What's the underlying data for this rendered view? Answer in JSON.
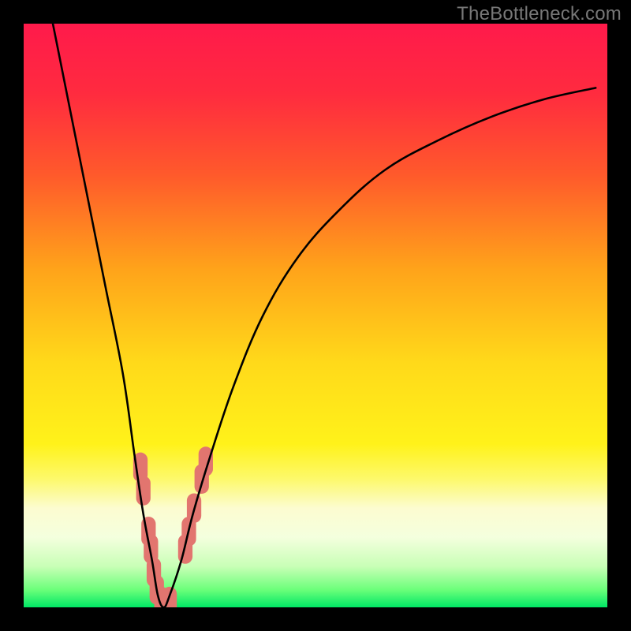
{
  "watermark": "TheBottleneck.com",
  "colors": {
    "frame": "#000000",
    "curve": "#000000",
    "dots": "#e2756f",
    "watermark": "#777777"
  },
  "gradient_stops": [
    {
      "pct": 0,
      "color": "#ff1a4b"
    },
    {
      "pct": 12,
      "color": "#ff2b3f"
    },
    {
      "pct": 26,
      "color": "#ff5a2b"
    },
    {
      "pct": 42,
      "color": "#ffa31a"
    },
    {
      "pct": 58,
      "color": "#ffd91a"
    },
    {
      "pct": 72,
      "color": "#fff21a"
    },
    {
      "pct": 78,
      "color": "#fdf96b"
    },
    {
      "pct": 83,
      "color": "#fcfcd0"
    },
    {
      "pct": 88,
      "color": "#f4ffde"
    },
    {
      "pct": 93,
      "color": "#c8ffb6"
    },
    {
      "pct": 97,
      "color": "#6bff7a"
    },
    {
      "pct": 100,
      "color": "#00e765"
    }
  ],
  "chart_data": {
    "type": "line",
    "title": "",
    "xlabel": "",
    "ylabel": "",
    "xlim": [
      0,
      100
    ],
    "ylim": [
      0,
      100
    ],
    "series": [
      {
        "name": "curve",
        "x": [
          5,
          8,
          11,
          14,
          17,
          19,
          20.5,
          22,
          23,
          24,
          25,
          27,
          29,
          32,
          36,
          41,
          47,
          54,
          62,
          71,
          80,
          89,
          98
        ],
        "y": [
          100,
          85,
          70,
          55,
          40,
          26,
          16,
          8,
          2,
          0,
          2,
          8,
          16,
          26,
          38,
          50,
          60,
          68,
          75,
          80,
          84,
          87,
          89
        ]
      }
    ],
    "highlight_dots": [
      {
        "x": 20.0,
        "y": 24
      },
      {
        "x": 20.5,
        "y": 20
      },
      {
        "x": 21.4,
        "y": 13
      },
      {
        "x": 21.8,
        "y": 10
      },
      {
        "x": 22.3,
        "y": 6
      },
      {
        "x": 22.8,
        "y": 3
      },
      {
        "x": 23.6,
        "y": 1
      },
      {
        "x": 24.2,
        "y": 0
      },
      {
        "x": 25.0,
        "y": 1
      },
      {
        "x": 27.7,
        "y": 10
      },
      {
        "x": 28.3,
        "y": 13
      },
      {
        "x": 29.2,
        "y": 17
      },
      {
        "x": 30.5,
        "y": 22
      },
      {
        "x": 31.2,
        "y": 25
      }
    ],
    "dot_radius": 1.3
  }
}
